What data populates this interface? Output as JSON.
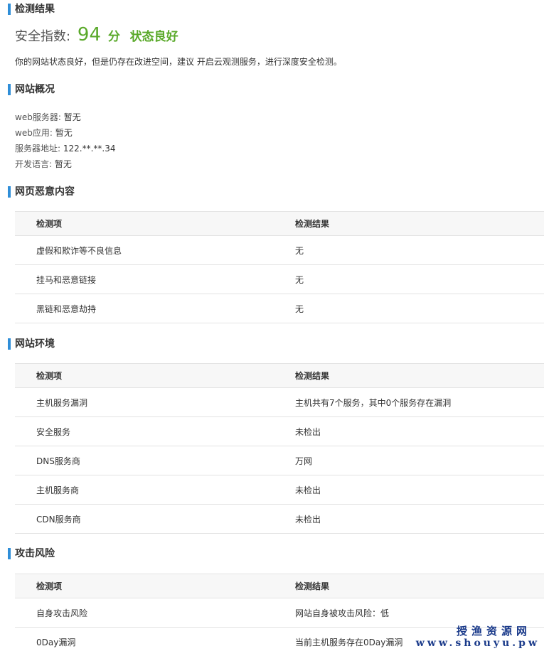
{
  "result": {
    "title": "检测结果",
    "score_label": "安全指数:",
    "score_value": "94",
    "score_unit": "分",
    "status": "状态良好",
    "description": "你的网站状态良好，但是仍存在改进空间，建议 开启云观测服务，进行深度安全检测。"
  },
  "overview": {
    "title": "网站概况",
    "items": [
      {
        "key": "web服务器:",
        "value": "暂无"
      },
      {
        "key": "web应用:",
        "value": "暂无"
      },
      {
        "key": "服务器地址:",
        "value": "122.**.**.34"
      },
      {
        "key": "开发语言:",
        "value": "暂无"
      }
    ]
  },
  "malicious": {
    "title": "网页恶意内容",
    "header": {
      "item": "检测项",
      "result": "检测结果"
    },
    "rows": [
      {
        "item": "虚假和欺诈等不良信息",
        "result": "无"
      },
      {
        "item": "挂马和恶意链接",
        "result": "无"
      },
      {
        "item": "黑链和恶意劫持",
        "result": "无"
      }
    ]
  },
  "environment": {
    "title": "网站环境",
    "header": {
      "item": "检测项",
      "result": "检测结果"
    },
    "rows": [
      {
        "item": "主机服务漏洞",
        "result": "主机共有7个服务，其中0个服务存在漏洞"
      },
      {
        "item": "安全服务",
        "result": "未检出"
      },
      {
        "item": "DNS服务商",
        "result": "万网"
      },
      {
        "item": "主机服务商",
        "result": "未检出"
      },
      {
        "item": "CDN服务商",
        "result": "未检出"
      }
    ]
  },
  "attack": {
    "title": "攻击风险",
    "header": {
      "item": "检测项",
      "result": "检测结果"
    },
    "rows": [
      {
        "item": "自身攻击风险",
        "result": "网站自身被攻击风险：低"
      },
      {
        "item": "0Day漏洞",
        "result": "当前主机服务存在0Day漏洞"
      }
    ]
  },
  "watermark": {
    "cn": "授渔资源网",
    "url": "www.shouyu.pw"
  },
  "colors": {
    "accent_bar": "#2f8ed8",
    "score_green": "#5aa92a",
    "watermark_blue": "#1a3a8a"
  }
}
